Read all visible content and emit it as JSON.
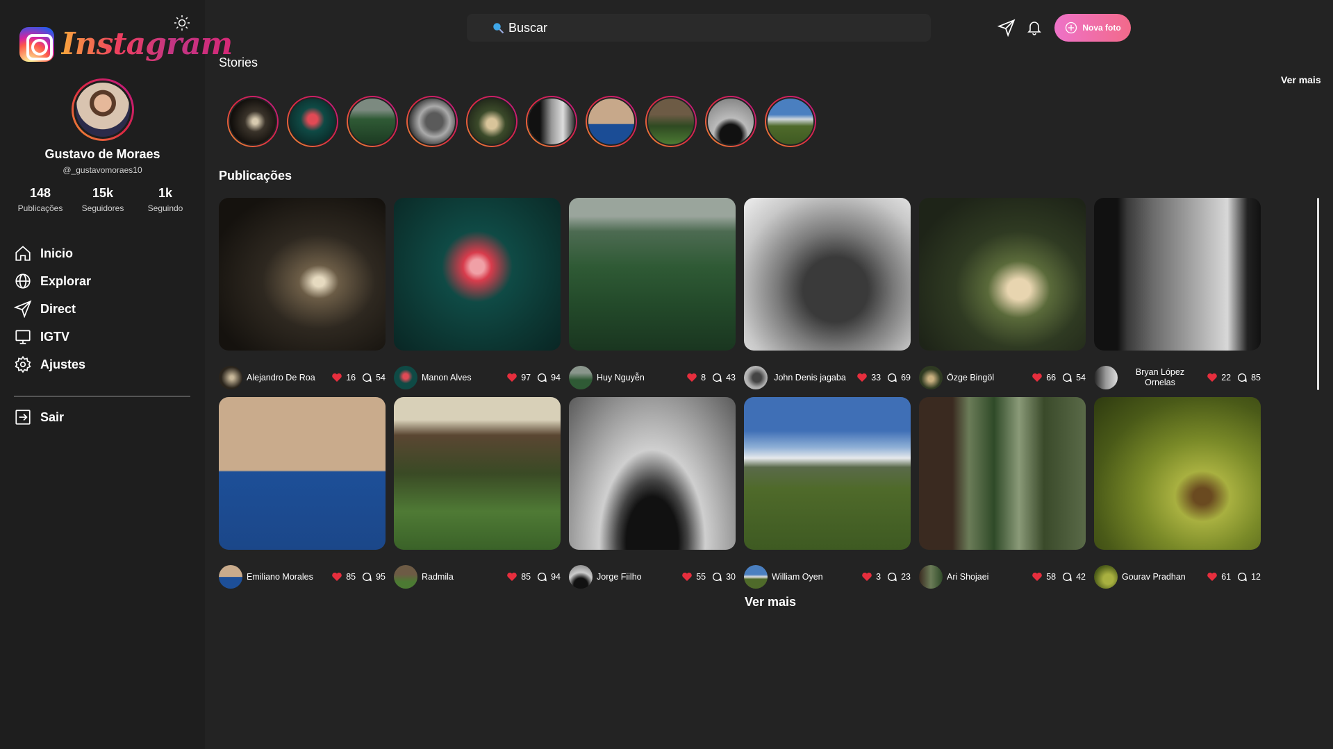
{
  "app": {
    "logo_text": "Instagram"
  },
  "profile": {
    "name": "Gustavo de Moraes",
    "handle": "@_gustavomoraes10",
    "stats": [
      {
        "value": "148",
        "label": "Publicações"
      },
      {
        "value": "15k",
        "label": "Seguidores"
      },
      {
        "value": "1k",
        "label": "Seguindo"
      }
    ]
  },
  "nav": {
    "items": [
      {
        "label": "Inicio",
        "icon": "home-icon"
      },
      {
        "label": "Explorar",
        "icon": "globe-icon"
      },
      {
        "label": "Direct",
        "icon": "send-icon"
      },
      {
        "label": "IGTV",
        "icon": "tv-icon"
      },
      {
        "label": "Ajustes",
        "icon": "gear-icon"
      }
    ],
    "logout": "Sair"
  },
  "header": {
    "search_text": "Buscar",
    "new_photo": "Nova foto"
  },
  "stories": {
    "title": "Stories",
    "see_more": "Ver mais"
  },
  "publications": {
    "title": "Publicações",
    "see_more": "Ver mais",
    "posts": [
      {
        "author": "Alejandro De Roa",
        "likes": "16",
        "comments": "54"
      },
      {
        "author": "Manon Alves",
        "likes": "97",
        "comments": "94"
      },
      {
        "author": "Huy Nguyễn",
        "likes": "8",
        "comments": "43"
      },
      {
        "author": "John Denis jagaba",
        "likes": "33",
        "comments": "69"
      },
      {
        "author": "Özge Bingöl",
        "likes": "66",
        "comments": "54"
      },
      {
        "author": "Bryan López Ornelas",
        "likes": "22",
        "comments": "85"
      },
      {
        "author": "Emiliano Morales",
        "likes": "85",
        "comments": "95"
      },
      {
        "author": "Radmila",
        "likes": "85",
        "comments": "94"
      },
      {
        "author": "Jorge Fiilho",
        "likes": "55",
        "comments": "30"
      },
      {
        "author": "William Oyen",
        "likes": "3",
        "comments": "23"
      },
      {
        "author": "Ari Shojaei",
        "likes": "58",
        "comments": "42"
      },
      {
        "author": "Gourav Pradhan",
        "likes": "61",
        "comments": "12"
      }
    ]
  },
  "colors": {
    "background": "#232323",
    "sidebar": "#1e1e1e",
    "heart": "#e62e3d",
    "accent": "#ee72c8"
  }
}
